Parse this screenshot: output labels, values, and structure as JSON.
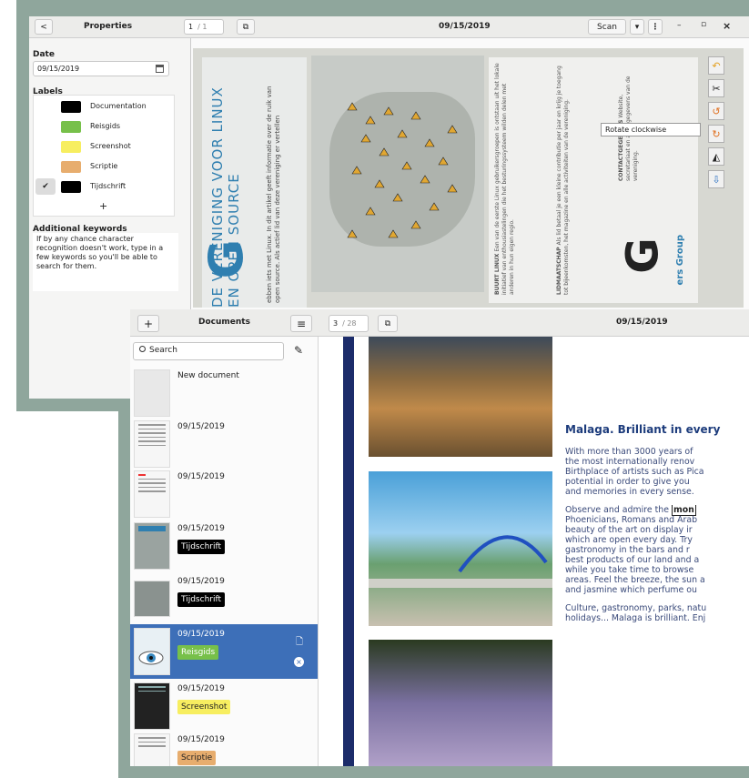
{
  "colors": {
    "accent": "#3d6fb8",
    "frame": "#8fa69c"
  },
  "props_window": {
    "back_label": "<",
    "title": "Properties",
    "page_current": "1",
    "page_total": "/ 1",
    "copy_icon": "copy-icon",
    "date_title": "09/15/2019",
    "scan_button": "Scan",
    "scan_dropdown": "▾",
    "menu": "⋮",
    "minimize": "–",
    "maximize": "▫",
    "close": "×",
    "date_section": "Date",
    "date_value": "09/15/2019",
    "labels_section": "Labels",
    "labels": [
      {
        "name": "Documentation",
        "color": "#000000",
        "checked": false
      },
      {
        "name": "Reisgids",
        "color": "#77c04a",
        "checked": false
      },
      {
        "name": "Screenshot",
        "color": "#f7ee60",
        "checked": false
      },
      {
        "name": "Scriptie",
        "color": "#e7ad6e",
        "checked": false
      },
      {
        "name": "Tijdschrift",
        "color": "#000000",
        "checked": true
      }
    ],
    "add_label": "+",
    "keywords_section": "Additional keywords",
    "keywords_text": "If by any chance character\nrecognition doesn't work, type in a\nfew keywords so you'll be able to\nsearch for them.",
    "tooltip": "Rotate clockwise",
    "scan_page": {
      "headline": "DE VERENIGING VOOR\nLINUX EN OPEN SOURCE",
      "big_letter": "G",
      "right_letter": "G",
      "col_heading_1": "BUURT LINUX",
      "col_heading_2": "LIDMAATSCHAP",
      "col_heading_3": "CONTACTGEGEVENS",
      "footer_text": "ers Group"
    },
    "toolbar_icons": [
      "undo-icon",
      "cut-icon",
      "rotate-counterclockwise-icon",
      "rotate-clockwise-icon",
      "color-icon",
      "save-icon"
    ]
  },
  "docs_window": {
    "add_label": "+",
    "title": "Documents",
    "menu_label": "≡",
    "page_current": "3",
    "page_total": "/ 28",
    "date_title": "09/15/2019",
    "search_placeholder": "Search",
    "documents": [
      {
        "date": "New document",
        "label": "",
        "label_color": "",
        "label_text_color": "",
        "selected": false
      },
      {
        "date": "09/15/2019",
        "label": "",
        "label_color": "",
        "label_text_color": "",
        "selected": false
      },
      {
        "date": "09/15/2019",
        "label": "",
        "label_color": "",
        "label_text_color": "",
        "selected": false
      },
      {
        "date": "09/15/2019",
        "label": "Tijdschrift",
        "label_color": "#000000",
        "label_text_color": "#ffffff",
        "selected": false
      },
      {
        "date": "09/15/2019",
        "label": "Tijdschrift",
        "label_color": "#000000",
        "label_text_color": "#ffffff",
        "selected": false
      },
      {
        "date": "09/15/2019",
        "label": "Reisgids",
        "label_color": "#77c04a",
        "label_text_color": "#ffffff",
        "selected": true
      },
      {
        "date": "09/15/2019",
        "label": "Screenshot",
        "label_color": "#f7ee60",
        "label_text_color": "#222222",
        "selected": false
      },
      {
        "date": "09/15/2019",
        "label": "Scriptie",
        "label_color": "#e7ad6e",
        "label_text_color": "#222222",
        "selected": false
      }
    ],
    "article": {
      "heading": "Malaga. Brilliant in every",
      "para1": "With more than 3000 years of\nthe most internationally renov\nBirthplace of artists such as Pica\npotential in order to give you\nand memories in every sense.",
      "para2_start": "Observe and admire the ",
      "para2_highlight": "mon",
      "para2_rest": "\nPhoenicians, Romans and Arab\nbeauty of the art on display ir\nwhich are open every day. Try\ngastronomy in the bars and r\nbest products of our land and a\nwhile you take time to browse\nareas. Feel the breeze, the sun a\nand jasmine which perfume ou",
      "para3": "Culture, gastronomy, parks, natu\nholidays... Malaga is brilliant. Enj"
    }
  }
}
